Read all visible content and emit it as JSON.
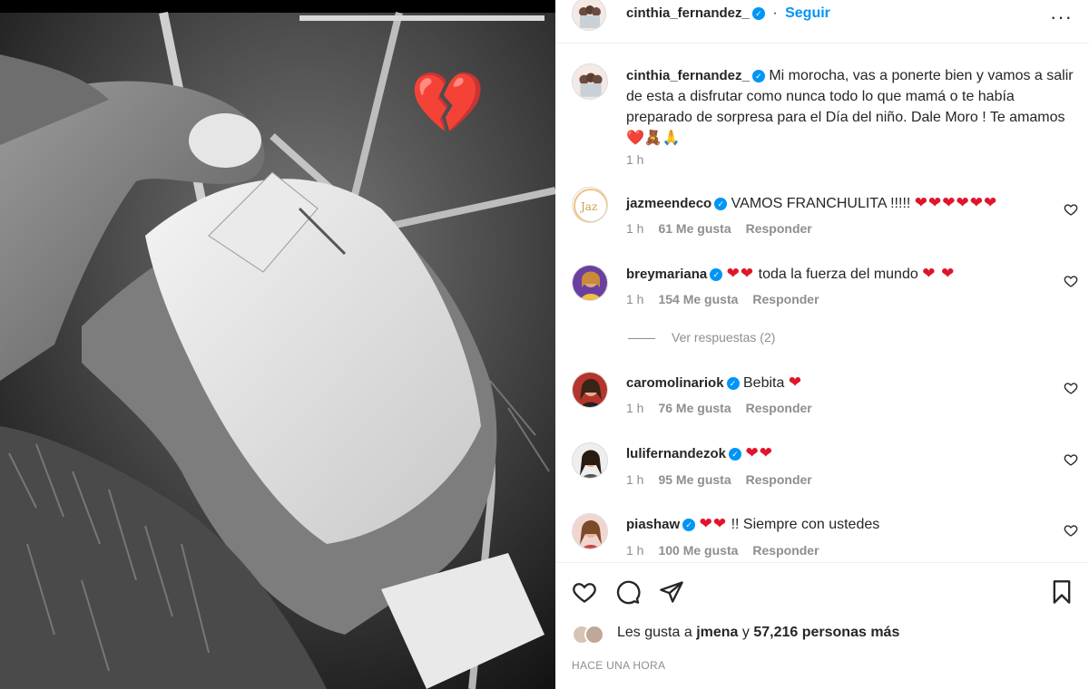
{
  "post": {
    "author": "cinthia_fernandez_",
    "follow_label": "Seguir",
    "more_label": "···",
    "caption": "Mi morocha, vas a ponerte bien y vamos a salir de esta a disfrutar como nunca todo lo que mamá o te había preparado de sorpresa para el Día del niño. Dale Moro ! Te amamos",
    "caption_emojis": "❤️🧸🙏",
    "caption_time": "1 h"
  },
  "photo": {
    "overlay_emoji": "💔"
  },
  "comments": [
    {
      "user": "jazmeendeco",
      "text": "VAMOS FRANCHULITA !!!!!",
      "emoji": "❤❤❤❤❤❤",
      "time": "1 h",
      "likes": "61 Me gusta",
      "reply": "Responder"
    },
    {
      "user": "breymariana",
      "emoji_before": "❤❤",
      "text": "toda la fuerza del mundo",
      "emoji": "❤ ❤",
      "time": "1 h",
      "likes": "154 Me gusta",
      "reply": "Responder"
    },
    {
      "user": "caromolinariok",
      "text": "Bebita",
      "emoji": "❤",
      "time": "1 h",
      "likes": "76 Me gusta",
      "reply": "Responder"
    },
    {
      "user": "lulifernandezok",
      "text": "",
      "emoji": "❤❤",
      "time": "1 h",
      "likes": "95 Me gusta",
      "reply": "Responder"
    },
    {
      "user": "piashaw",
      "emoji_before": "❤❤",
      "text": "!! Siempre con ustedes",
      "time": "1 h",
      "likes": "100 Me gusta",
      "reply": "Responder"
    }
  ],
  "view_replies": "Ver respuestas (2)",
  "likes_summary": {
    "prefix": "Les gusta a",
    "user": "jmena",
    "joiner": "y",
    "count": "57,216 personas más"
  },
  "post_time": "HACE UNA HORA",
  "colors": {
    "accent": "#0095f6",
    "heart": "#e0142b",
    "muted": "#8e8e8e"
  }
}
